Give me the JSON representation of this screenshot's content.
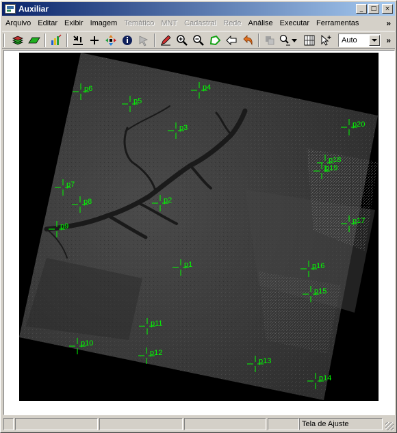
{
  "window": {
    "title": "Auxiliar",
    "controls": {
      "minimize": "_",
      "maximize": "□",
      "close": "×"
    }
  },
  "menu": {
    "items": [
      {
        "label": "Arquivo",
        "enabled": true
      },
      {
        "label": "Editar",
        "enabled": true
      },
      {
        "label": "Exibir",
        "enabled": true
      },
      {
        "label": "Imagem",
        "enabled": true
      },
      {
        "label": "Temático",
        "enabled": false
      },
      {
        "label": "MNT",
        "enabled": false
      },
      {
        "label": "Cadastral",
        "enabled": false
      },
      {
        "label": "Rede",
        "enabled": false
      },
      {
        "label": "Análise",
        "enabled": true
      },
      {
        "label": "Executar",
        "enabled": true
      },
      {
        "label": "Ferramentas",
        "enabled": true
      }
    ],
    "overflow": "»"
  },
  "toolbar": {
    "tools": [
      "layers-stack-icon",
      "green-plane-icon",
      "chart-draw-icon",
      "display-cursor-icon",
      "crosshair-add-icon",
      "pan-move-icon",
      "info-icon",
      "disabled-pointer-icon",
      "pencil-edit-icon",
      "zoom-in-icon",
      "zoom-out-icon",
      "polygon-select-icon",
      "back-arrow-icon",
      "undo-icon",
      "disabled-gray-icon",
      "zoom-scale-icon",
      "dropdown-arrow-icon",
      "grid-tool-icon",
      "select-pointer-icon"
    ],
    "zoom_value": "Auto",
    "overflow": "»"
  },
  "image": {
    "accent_color": "#00ff00",
    "control_points": [
      {
        "label": "p1"
      },
      {
        "label": "p2"
      },
      {
        "label": "p3"
      },
      {
        "label": "p4"
      },
      {
        "label": "p5"
      },
      {
        "label": "p6"
      },
      {
        "label": "p7"
      },
      {
        "label": "p8"
      },
      {
        "label": "p9"
      },
      {
        "label": "p10"
      },
      {
        "label": "p11"
      },
      {
        "label": "p12"
      },
      {
        "label": "p13"
      },
      {
        "label": "p14"
      },
      {
        "label": "p15"
      },
      {
        "label": "p16"
      },
      {
        "label": "p17"
      },
      {
        "label": "p18"
      },
      {
        "label": "p19"
      },
      {
        "label": "p20"
      }
    ]
  },
  "status": {
    "panels": [
      "",
      "",
      "",
      "",
      "Tela de Ajuste"
    ]
  }
}
